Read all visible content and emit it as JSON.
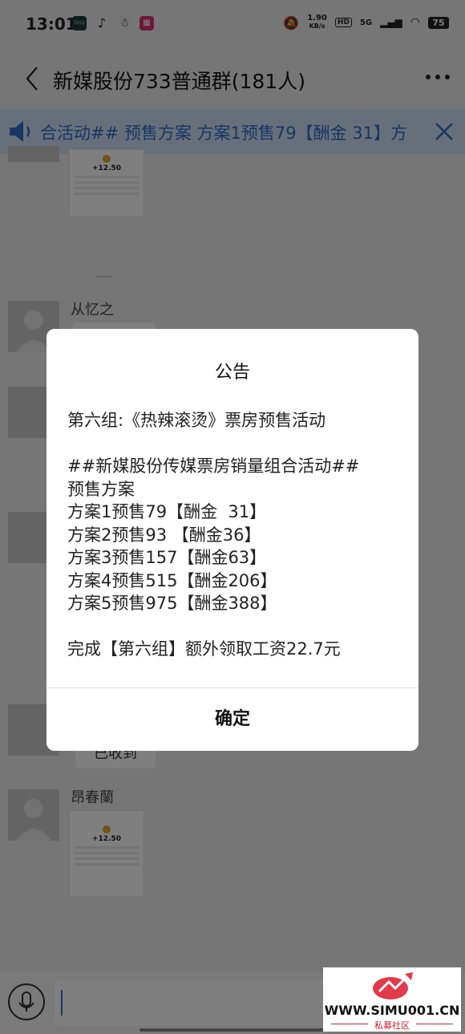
{
  "status_bar": {
    "time": "13:01",
    "net_speed_value": "1.90",
    "net_speed_unit": "KB/s",
    "hd": "HD",
    "network": "5G",
    "battery": "75",
    "icons": [
      "orig-app-icon",
      "tiktok-icon",
      "qq-icon",
      "shop-icon",
      "mute-bell-icon",
      "wifi-icon"
    ]
  },
  "header": {
    "title": "新媒股份733普通群(181人)"
  },
  "notice_bar": {
    "text": "合活动## 预售方案 方案1预售79【酬金  31】方",
    "color": "#2f6cc9"
  },
  "chat": {
    "messages": [
      {
        "sender": "从忆之"
      },
      {
        "sender": "昂春蘭"
      }
    ],
    "receipt_amount": "+12.50",
    "received_label": "已收到"
  },
  "dialog": {
    "title": "公告",
    "body": "第六组:《热辣滚烫》票房预售活动\n\n##新媒股份传媒票房销量组合活动##\n预售方案\n方案1预售79【酬金  31】\n方案2预售93 【酬金36】\n方案3预售157【酬金63】\n方案4预售515【酬金206】\n方案5预售975【酬金388】\n\n完成【第六组】额外领取工资22.7元",
    "confirm_label": "确定"
  },
  "watermark": {
    "site": "WWW.SIMU001.CN",
    "sub": "私募社区"
  }
}
